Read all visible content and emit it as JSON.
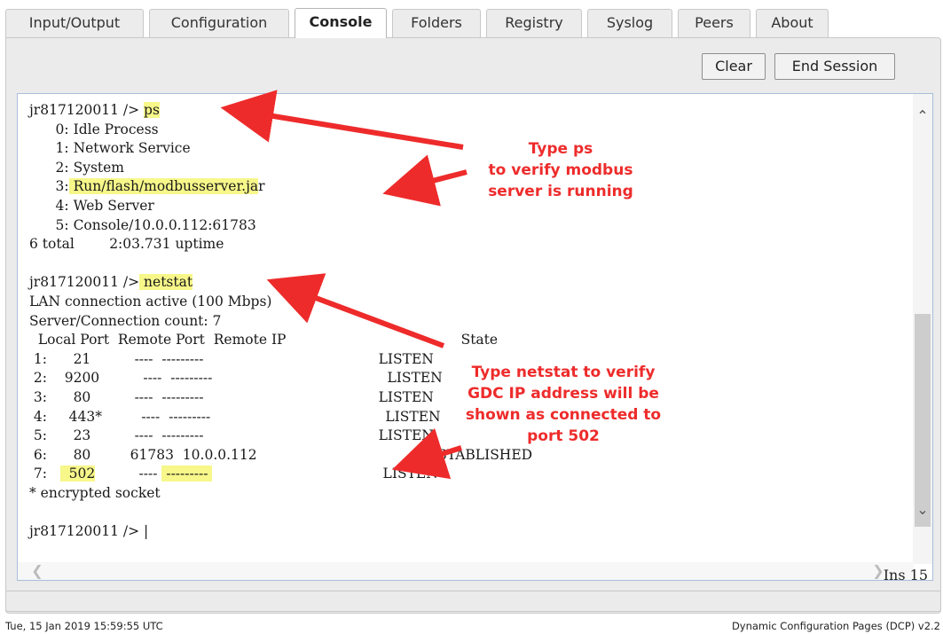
{
  "tabs": [
    {
      "label": "Input/Output",
      "active": false
    },
    {
      "label": "Configuration",
      "active": false
    },
    {
      "label": "Console",
      "active": true
    },
    {
      "label": "Folders",
      "active": false
    },
    {
      "label": "Registry",
      "active": false
    },
    {
      "label": "Syslog",
      "active": false
    },
    {
      "label": "Peers",
      "active": false
    },
    {
      "label": "About",
      "active": false
    }
  ],
  "toolbar": {
    "clear_label": "Clear",
    "end_session_label": "End Session"
  },
  "console": {
    "lines": [
      "jr817120011 /> ps",
      "      0: Idle Process",
      "      1: Network Service",
      "      2: System",
      "      3: Run/flash/modbusserver.jar",
      "      4: Web Server",
      "      5: Console/10.0.0.112:61783",
      "6 total        2:03.731 uptime",
      "",
      "jr817120011 /> netstat",
      "LAN connection active (100 Mbps)",
      "Server/Connection count: 7",
      "  Local Port  Remote Port  Remote IP                                        State",
      " 1:      21          ----  ---------                                        LISTEN",
      " 2:    9200          ----  ---------                                        LISTEN",
      " 3:      80          ----  ---------                                        LISTEN",
      " 4:     443*         ----  ---------                                        LISTEN",
      " 5:      23          ----  ---------                                        LISTEN",
      " 6:      80         61783  10.0.0.112                                       ESTABLISHED",
      " 7:     502          ----  ---------                                        LISTEN",
      "* encrypted socket",
      "",
      "jr817120011 /> |"
    ]
  },
  "annotations": {
    "ps_note": [
      "Type  ps",
      "to verify modbus",
      "server is running"
    ],
    "netstat_note": [
      "Type  netstat  to verify",
      "GDC IP address will be",
      "shown as connected to",
      "port 502"
    ]
  },
  "insert_mode": "Ins 15",
  "footer": {
    "timestamp": "Tue, 15 Jan 2019 15:59:55 UTC",
    "app_name": "Dynamic Configuration Pages (DCP) v2.2"
  },
  "colors": {
    "annotation": "#ee2b2b",
    "highlight": "#f7f78a",
    "active_tab": "#ffffff"
  }
}
